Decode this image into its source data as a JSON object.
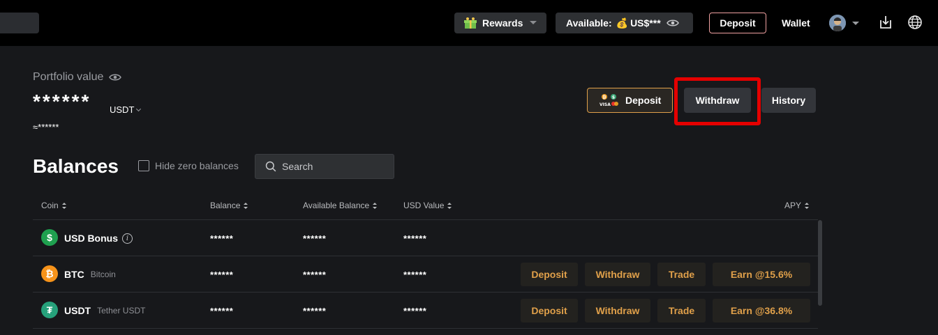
{
  "topbar": {
    "rewards_label": "Rewards",
    "available_label": "Available:",
    "available_value": "US$***",
    "deposit_label": "Deposit",
    "wallet_label": "Wallet"
  },
  "portfolio": {
    "label": "Portfolio value",
    "value": "******",
    "unit": "USDT",
    "approx": "≈******"
  },
  "actions": {
    "deposit_label": "Deposit",
    "withdraw_label": "Withdraw",
    "history_label": "History"
  },
  "balances": {
    "title": "Balances",
    "hide_zero_label": "Hide zero balances",
    "search_placeholder": "Search",
    "columns": {
      "coin": "Coin",
      "balance": "Balance",
      "available": "Available Balance",
      "usd_value": "USD Value",
      "apy": "APY"
    },
    "rows": [
      {
        "symbol": "USD Bonus",
        "name": "",
        "balance": "******",
        "available": "******",
        "usd_value": "******"
      },
      {
        "symbol": "BTC",
        "name": "Bitcoin",
        "balance": "******",
        "available": "******",
        "usd_value": "******",
        "deposit": "Deposit",
        "withdraw": "Withdraw",
        "trade": "Trade",
        "earn": "Earn @15.6%"
      },
      {
        "symbol": "USDT",
        "name": "Tether USDT",
        "balance": "******",
        "available": "******",
        "usd_value": "******",
        "deposit": "Deposit",
        "withdraw": "Withdraw",
        "trade": "Trade",
        "earn": "Earn @36.8%"
      }
    ]
  },
  "colors": {
    "accent": "#e0a04a",
    "highlight": "#e50000",
    "background": "#17181b",
    "topbar": "#000000"
  }
}
